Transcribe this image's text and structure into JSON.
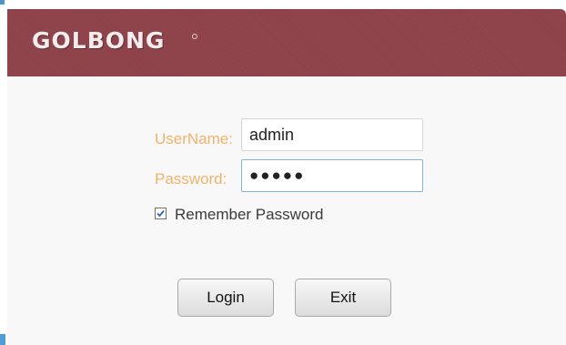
{
  "header": {
    "logo_text": "GOLBONG",
    "background_color": "#8f4249"
  },
  "form": {
    "username_label": "UserName:",
    "username_value": "admin",
    "password_label": "Password:",
    "password_value": "●●●●●",
    "remember_label": "Remember Password",
    "remember_checked": true,
    "label_color": "#f1b36a"
  },
  "buttons": {
    "login_label": "Login",
    "exit_label": "Exit"
  }
}
